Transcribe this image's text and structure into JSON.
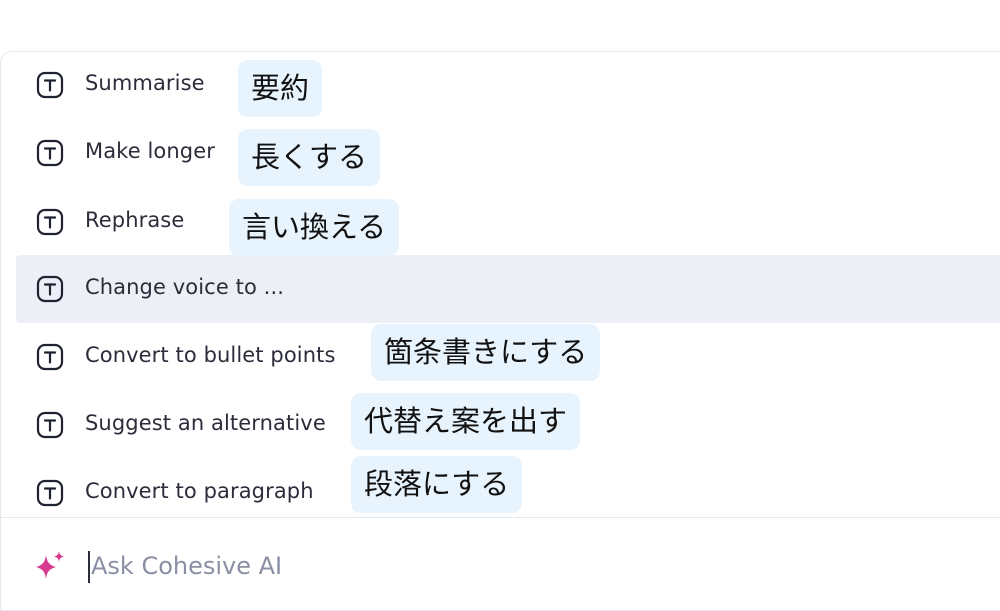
{
  "menu": {
    "items": [
      {
        "label": "Summarise",
        "note": "要約",
        "active": false
      },
      {
        "label": "Make longer",
        "note": "長くする",
        "active": false
      },
      {
        "label": "Rephrase",
        "note": "言い換える",
        "active": false
      },
      {
        "label": "Change voice to ...",
        "note": "",
        "active": true
      },
      {
        "label": "Convert to bullet points",
        "note": "箇条書きにする",
        "active": false
      },
      {
        "label": "Suggest an alternative",
        "note": "代替え案を出す",
        "active": false
      },
      {
        "label": "Convert to paragraph",
        "note": "段落にする",
        "active": false
      }
    ],
    "item_icon": "text-t-icon"
  },
  "ask": {
    "placeholder": "Ask Cohesive AI",
    "value": "",
    "icon": "sparkle-icon",
    "icon_color": "#d63a8f"
  },
  "colors": {
    "active_row": "#eceff5",
    "note_bubble": "#e8f4fd"
  }
}
